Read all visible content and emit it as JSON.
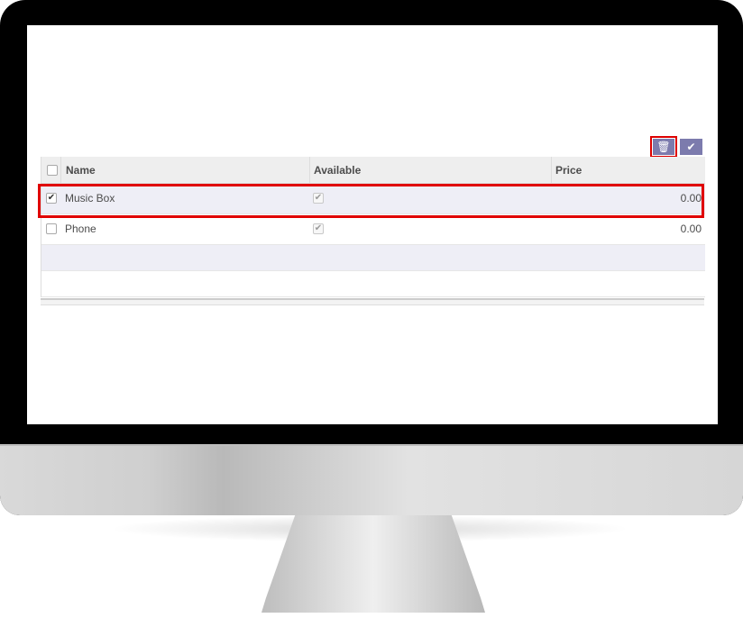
{
  "toolbar": {
    "delete_icon": "trash-icon",
    "save_icon": "check-icon"
  },
  "table": {
    "columns": [
      "Name",
      "Available",
      "Price"
    ],
    "rows": [
      {
        "name": "Music Box",
        "available": true,
        "price": "0.00",
        "selected": true
      },
      {
        "name": "Phone",
        "available": true,
        "price": "0.00",
        "selected": false
      }
    ]
  },
  "colors": {
    "accent": "#7c7bad",
    "highlight": "#e00000",
    "selected_row": "#eeeef6"
  }
}
